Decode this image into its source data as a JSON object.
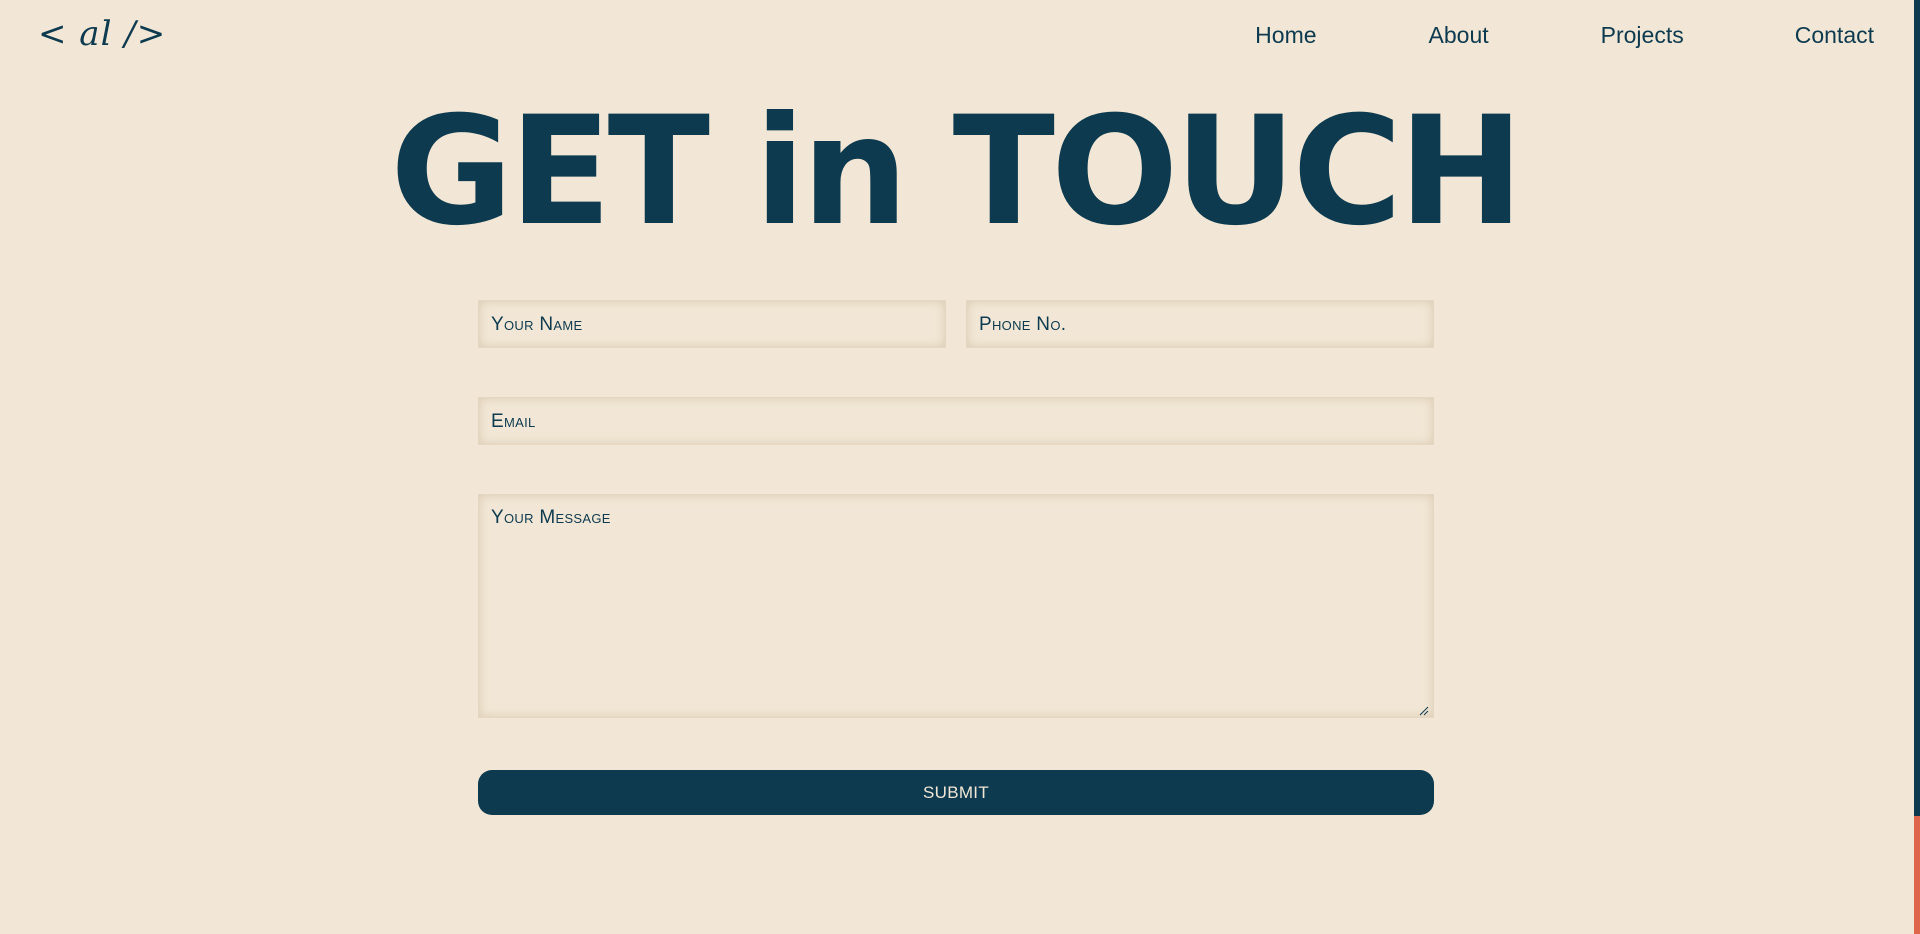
{
  "logo": {
    "text": "< al />"
  },
  "nav": {
    "items": [
      "Home",
      "About",
      "Projects",
      "Contact"
    ]
  },
  "heading": {
    "text": "GET in TOUCH"
  },
  "form": {
    "name_placeholder": "Your Name",
    "phone_placeholder": "Phone No.",
    "email_placeholder": "Email",
    "message_placeholder": "Your Message",
    "submit_label": "SUBMIT"
  },
  "colors": {
    "background": "#f2e7d6",
    "primary": "#0d3a4e",
    "scroll_accent": "#e0664b"
  },
  "icons": {
    "resize": "resize-handle-icon"
  }
}
